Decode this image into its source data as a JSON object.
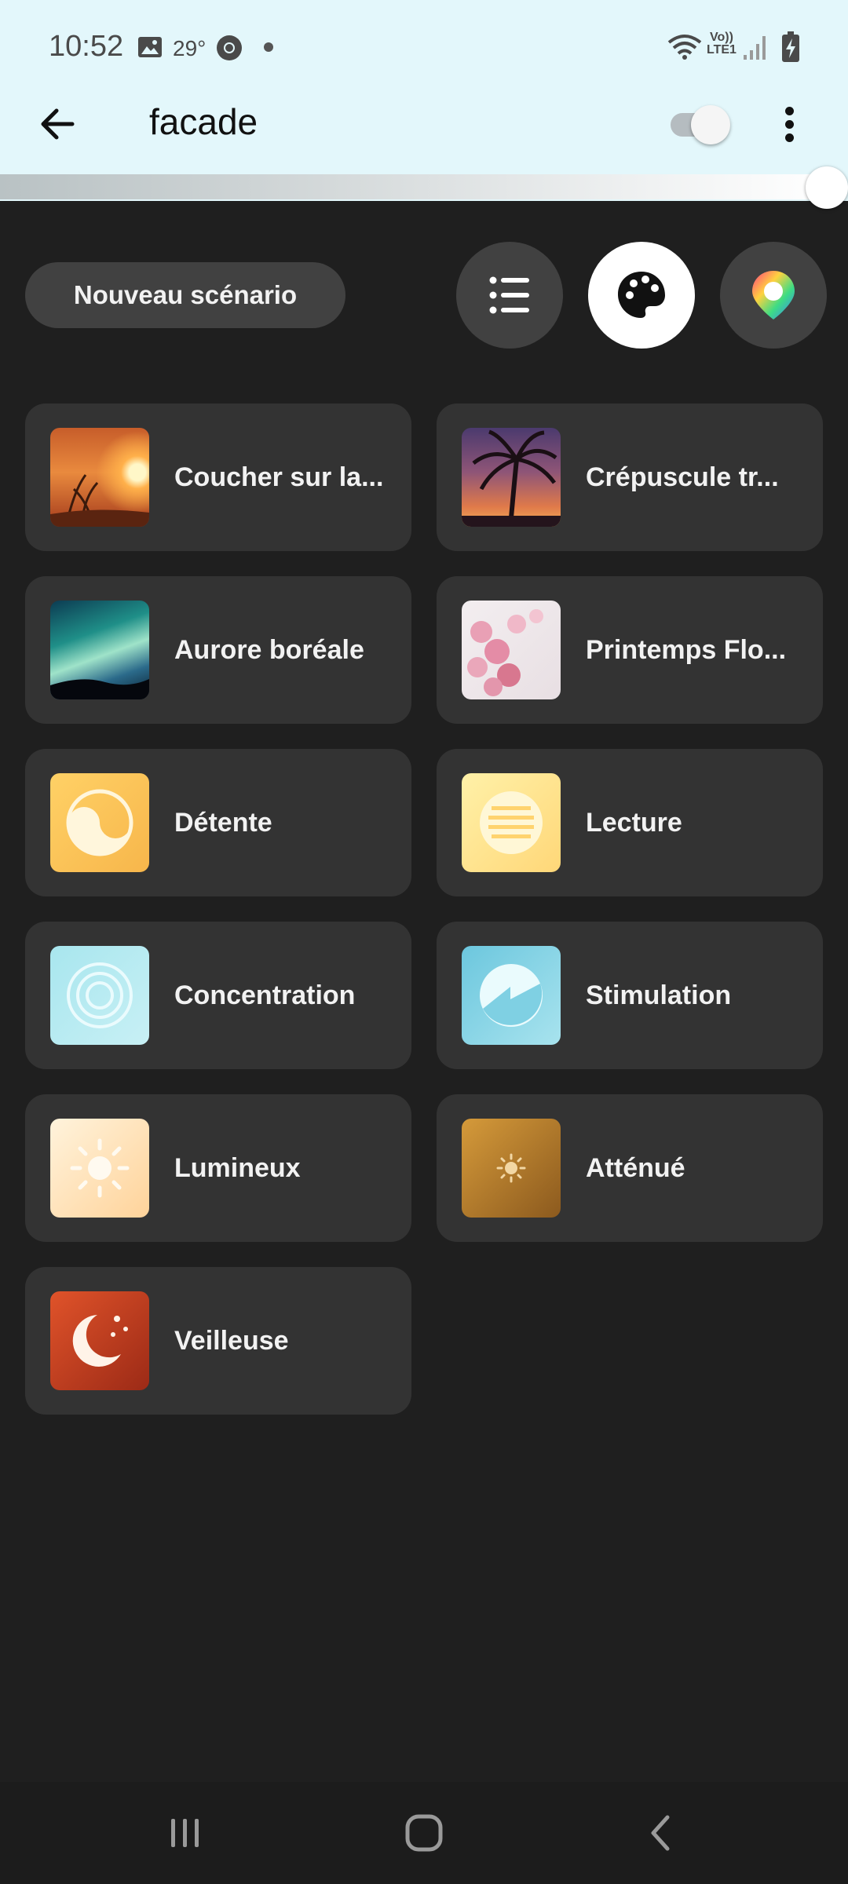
{
  "status_bar": {
    "time": "10:52",
    "temperature": "29°",
    "volte_line1": "Vo))",
    "volte_line2": "LTE1"
  },
  "app_bar": {
    "title": "facade",
    "power_on": true
  },
  "brightness": {
    "level_percent": 100
  },
  "toolbar": {
    "new_scene_label": "Nouveau scénario",
    "modes": [
      "list-icon",
      "palette-icon",
      "color-picker-icon"
    ],
    "active_mode": "palette-icon"
  },
  "scenes": [
    {
      "label": "Coucher sur la...",
      "thumb": "sunset-photo"
    },
    {
      "label": "Crépuscule tr...",
      "thumb": "palm-dusk-photo"
    },
    {
      "label": "Aurore boréale",
      "thumb": "aurora-photo"
    },
    {
      "label": "Printemps Flo...",
      "thumb": "blossom-photo"
    },
    {
      "label": "Détente",
      "thumb": "yin-yang-icon"
    },
    {
      "label": "Lecture",
      "thumb": "reading-icon"
    },
    {
      "label": "Concentration",
      "thumb": "target-icon"
    },
    {
      "label": "Stimulation",
      "thumb": "energize-icon"
    },
    {
      "label": "Lumineux",
      "thumb": "bright-sun-icon"
    },
    {
      "label": "Atténué",
      "thumb": "dim-sun-icon"
    },
    {
      "label": "Veilleuse",
      "thumb": "moon-icon"
    }
  ],
  "colors": {
    "header_bg": "#e3f7fb",
    "page_bg": "#1f1f1f",
    "card_bg": "#333333"
  }
}
